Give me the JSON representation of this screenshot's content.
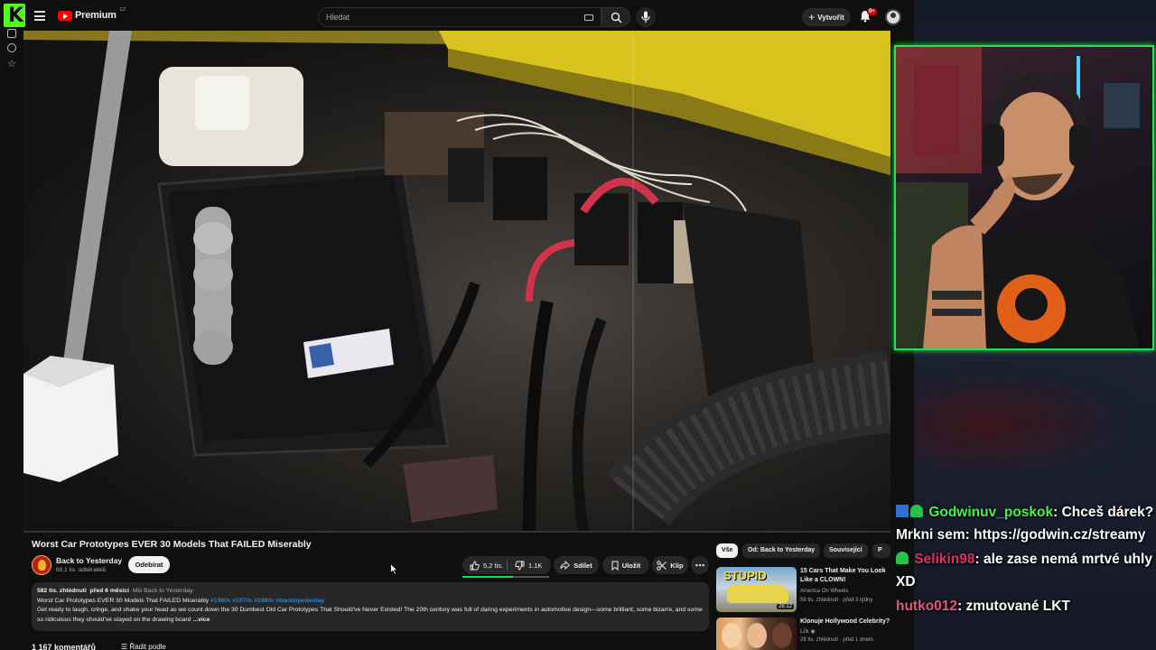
{
  "app": {
    "logo_letter": "K",
    "yt_logo_text": "Premium",
    "yt_region": "CZ",
    "search_placeholder": "Hledat",
    "create_label": "Vytvořit",
    "notification_count": "9+"
  },
  "video": {
    "title": "Worst Car Prototypes EVER 30 Models That FAILED Miserably",
    "channel_name": "Back to Yesterday",
    "subscribers": "69,1 tis. odběratelů",
    "subscribe_label": "Odebírat",
    "likes": "5,2 tis.",
    "dislikes": "1.1K",
    "like_ratio": 0.58,
    "share_label": "Sdílet",
    "save_label": "Uložit",
    "clip_label": "Klip",
    "description": {
      "views": "582 tis. zhlédnutí",
      "age": "před 6 měsíci",
      "mix": "Mix Back to Yesterday",
      "line_title": "Worst Car Prototypes EVER 30 Models That FAILED Miserably",
      "tags": "#1960s #1970s #1980s #backtoyesterday",
      "body": "Get ready to laugh, cringe, and shake your head as we count down the 30 Dumbest Old Car Prototypes That Should've Never Existed! The 20th century was full of daring experiments in automotive design—some brilliant, some bizarre, and some so ridiculous they should've stayed on the drawing board",
      "more": "...více"
    },
    "comments_count": "1 167 komentářů",
    "sort_label": "Řadit podle"
  },
  "chips": [
    "Vše",
    "Od: Back to Yesterday",
    "Související",
    "P"
  ],
  "recommendations": [
    {
      "title": "15 Cars That Make You Look Like a CLOWN!",
      "channel": "America On Wheels",
      "meta": "59 tis. zhlédnutí · před 3 týdny",
      "duration": "26:12",
      "thumb_text": "STUPID"
    },
    {
      "title": "Klonuje Hollywood Celebrity?",
      "channel": "Lůk",
      "meta": "28 tis. zhlédnutí · před 1 dnem",
      "duration": "",
      "thumb_text": ""
    }
  ],
  "chat": [
    {
      "user": "Godwinuv_poskok",
      "color": "#4cf04c",
      "message": ": Chceš dárek? Mrkni sem: https://godwin.cz/streamy"
    },
    {
      "user": "Selikin98",
      "color": "#e0306a",
      "message": ": ale zase nemá mrtvé uhly XD"
    },
    {
      "user": "hutko012",
      "color": "#e05a7a",
      "message": ": zmutované LKT"
    }
  ]
}
